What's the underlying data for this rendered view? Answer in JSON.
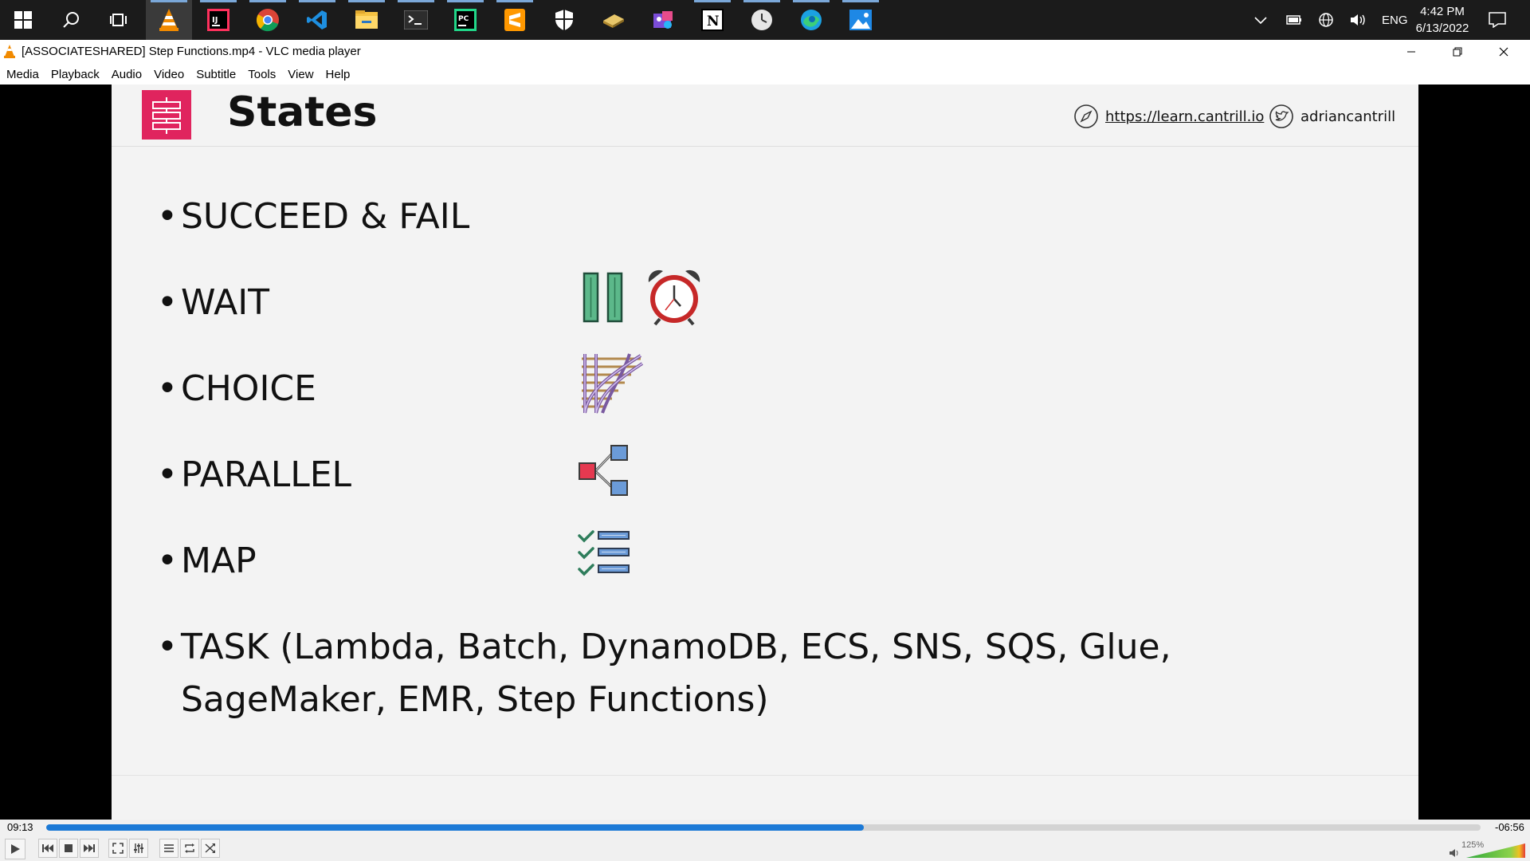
{
  "taskbar": {
    "apps": [
      "start-icon",
      "search-icon",
      "task-view-icon",
      "vlc-icon",
      "intellij-icon",
      "chrome-icon",
      "vscode-icon",
      "file-explorer-icon",
      "terminal-icon",
      "pycharm-icon",
      "sublime-icon",
      "security-icon",
      "notes-icon",
      "media-app-icon",
      "notion-icon",
      "clock-app-icon",
      "edge-icon",
      "photos-icon"
    ],
    "tray_lang": "ENG",
    "clock_time": "4:42 PM",
    "clock_date": "6/13/2022"
  },
  "window": {
    "title": "[ASSOCIATESHARED] Step Functions.mp4 - VLC media player"
  },
  "menu": [
    "Media",
    "Playback",
    "Audio",
    "Video",
    "Subtitle",
    "Tools",
    "View",
    "Help"
  ],
  "slide": {
    "title": "States",
    "link_url": "https://learn.cantrill.io",
    "twitter": "adriancantrill",
    "bullets": [
      "SUCCEED & FAIL",
      "WAIT",
      "CHOICE",
      "PARALLEL",
      "MAP",
      "TASK (Lambda, Batch, DynamoDB, ECS, SNS, SQS, Glue,",
      "SageMaker, EMR, Step Functions)"
    ]
  },
  "player": {
    "elapsed": "09:13",
    "remaining": "-06:56",
    "progress": 0.57,
    "volume_label": "125%",
    "volume": 1.25
  },
  "colors": {
    "accent": "#1b79d6",
    "aws_pink": "#e0245e"
  }
}
